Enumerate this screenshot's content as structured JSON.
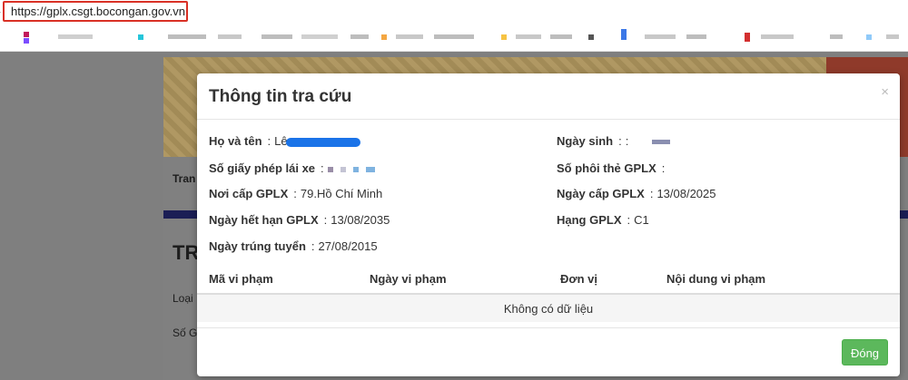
{
  "browser": {
    "url": "https://gplx.csgt.bocongan.gov.vn"
  },
  "background_page": {
    "nav_text": "Tran",
    "heading_text": "TR",
    "label_1": "Loại",
    "label_2": "Số G"
  },
  "modal": {
    "title": "Thông tin tra cứu",
    "close_symbol": "×",
    "fields": {
      "name": {
        "label": "Họ và tên",
        "value": "Lê"
      },
      "birthdate": {
        "label": "Ngày sinh",
        "value": ":"
      },
      "license_number": {
        "label": "Số giấy phép lái xe",
        "value": ""
      },
      "card_serial": {
        "label": "Số phôi thẻ GPLX",
        "value": ""
      },
      "issue_place": {
        "label": "Nơi cấp GPLX",
        "value": "79.Hồ Chí Minh"
      },
      "issue_date": {
        "label": "Ngày cấp GPLX",
        "value": "13/08/2025"
      },
      "expiry_date": {
        "label": "Ngày hết hạn GPLX",
        "value": "13/08/2035"
      },
      "license_class": {
        "label": "Hạng GPLX",
        "value": "C1"
      },
      "pass_date": {
        "label": "Ngày trúng tuyển",
        "value": "27/08/2015"
      }
    },
    "separator": ":",
    "table": {
      "headers": [
        "Mã vi phạm",
        "Ngày vi phạm",
        "Đơn vị",
        "Nội dung vi phạm"
      ],
      "empty_text": "Không có dữ liệu"
    },
    "close_button": "Đóng"
  },
  "colors": {
    "primary_button": "#5cb85c",
    "redaction_blue": "#1a73e8",
    "address_highlight": "#d93025"
  }
}
